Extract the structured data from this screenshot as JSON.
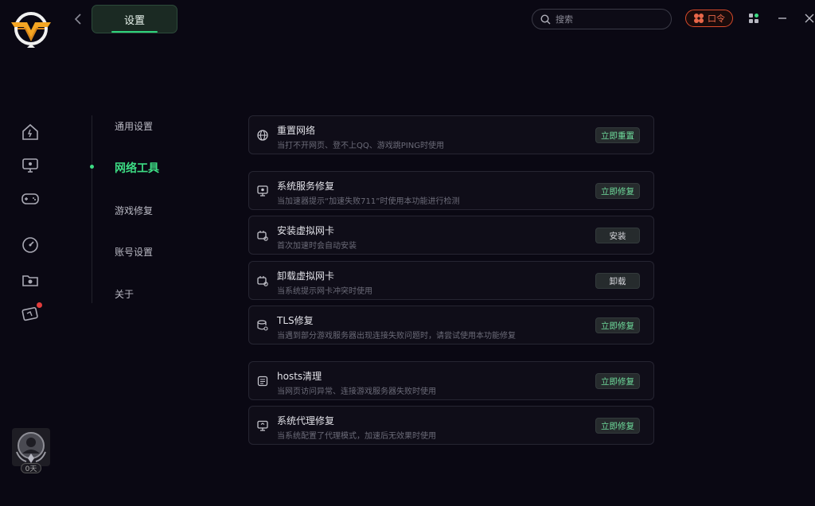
{
  "header": {
    "title": "设置",
    "search_placeholder": "搜索",
    "koulin_label": "口令"
  },
  "menu": {
    "items": [
      {
        "label": "通用设置",
        "active": false
      },
      {
        "label": "网络工具",
        "active": true
      },
      {
        "label": "游戏修复",
        "active": false
      },
      {
        "label": "账号设置",
        "active": false
      },
      {
        "label": "关于",
        "active": false
      }
    ]
  },
  "tools": [
    {
      "title": "重置网络",
      "desc": "当打不开网页、登不上QQ、游戏跳PING时使用",
      "button": "立即重置",
      "icon": "globe-icon"
    },
    {
      "title": "系统服务修复",
      "desc": "当加速器提示“加速失败711”时使用本功能进行检测",
      "button": "立即修复",
      "icon": "monitor-service-icon"
    },
    {
      "title": "安装虚拟网卡",
      "desc": "首次加速时会自动安装",
      "button": "安装",
      "icon": "network-card-icon"
    },
    {
      "title": "卸载虚拟网卡",
      "desc": "当系统提示网卡冲突时使用",
      "button": "卸载",
      "icon": "network-card-icon"
    },
    {
      "title": "TLS修复",
      "desc": "当遇到部分游戏服务器出现连接失败问题时，请尝试使用本功能修复",
      "button": "立即修复",
      "icon": "database-gear-icon"
    },
    {
      "title": "hosts清理",
      "desc": "当网页访问异常、连接游戏服务器失败时使用",
      "button": "立即修复",
      "icon": "list-doc-icon"
    },
    {
      "title": "系统代理修复",
      "desc": "当系统配置了代理模式，加速后无效果时使用",
      "button": "立即修复",
      "icon": "monitor-proxy-icon"
    }
  ],
  "user": {
    "days": "0天"
  },
  "colors": {
    "accent": "#3ddc84",
    "background": "#0a0813",
    "alert": "#e8674a"
  }
}
